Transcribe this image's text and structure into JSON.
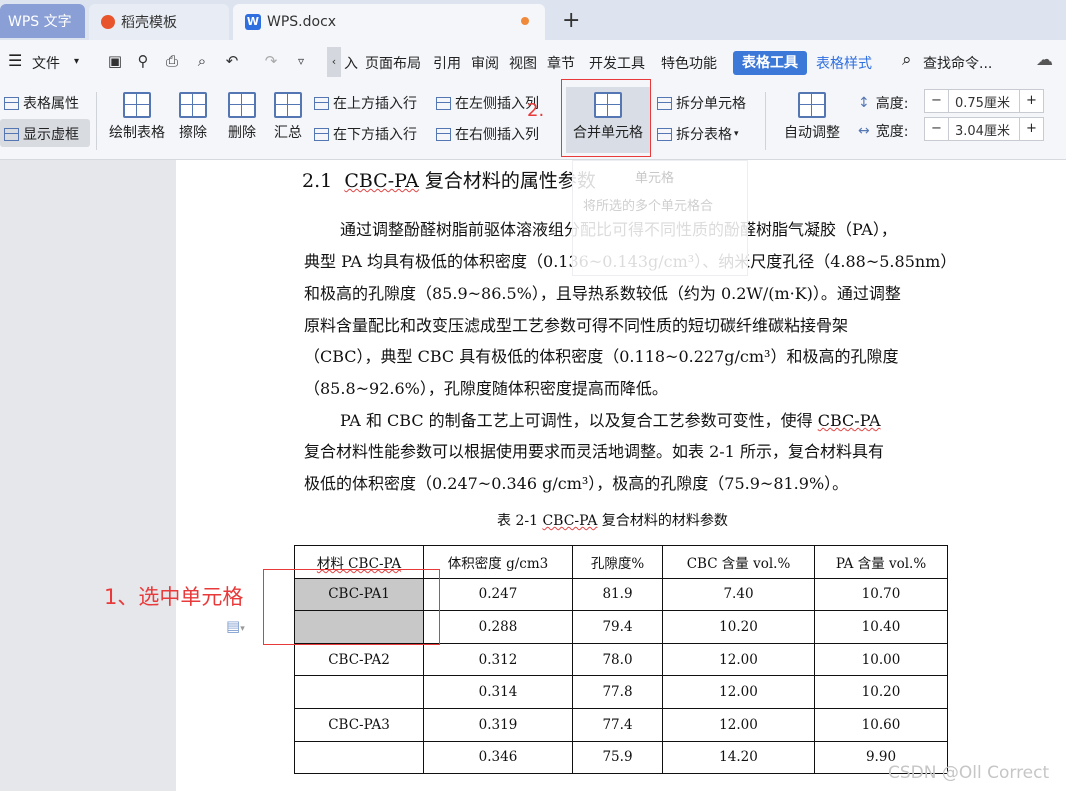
{
  "tabs": {
    "app": "WPS 文字",
    "template": "稻壳模板",
    "doc": "WPS.docx",
    "doc_icon": "W",
    "new_tab": "+"
  },
  "menu": {
    "file": "文件",
    "collapse": "‹",
    "insert_partial": "入",
    "page_layout": "页面布局",
    "references": "引用",
    "review": "审阅",
    "view": "视图",
    "chapter": "章节",
    "dev_tools": "开发工具",
    "special": "特色功能",
    "table_tools": "表格工具",
    "table_style": "表格样式",
    "search": "查找命令..."
  },
  "ribbon": {
    "table_props": "表格属性",
    "show_grid": "显示虚框",
    "draw_table": "绘制表格",
    "erase": "擦除",
    "delete": "删除",
    "summary": "汇总",
    "insert_above": "在上方插入行",
    "insert_below": "在下方插入行",
    "insert_left": "在左侧插入列",
    "insert_right": "在右侧插入列",
    "merge_cells": "合并单元格",
    "split_cells": "拆分单元格",
    "split_table": "拆分表格",
    "auto_fit": "自动调整",
    "height_label": "高度:",
    "height_value": "0.75厘米",
    "width_label": "宽度:",
    "width_value": "3.04厘米"
  },
  "tooltip": {
    "title": "单元格",
    "desc": "将所选的多个单元格合"
  },
  "annotations": {
    "step1": "1、选中单元格",
    "step2": "2."
  },
  "document": {
    "heading_num": "2.1",
    "heading_sq": "CBC-PA",
    "heading_rest": " 复合材料的属性参数",
    "p1_l1": "通过调整酚醛树脂前驱体溶液组分配比可得不同性质的酚醛树脂气凝胶（PA），",
    "p1_l2": "典型 PA 均具有极低的体积密度（0.136~0.143g/cm³）、纳米尺度孔径（4.88~5.85nm）",
    "p1_l3": "和极高的孔隙度（85.9~86.5%），且导热系数较低（约为 0.2W/(m·K)）。通过调整",
    "p1_l4": "原料含量配比和改变压滤成型工艺参数可得不同性质的短切碳纤维碳粘接骨架",
    "p1_l5": "（CBC），典型 CBC 具有极低的体积密度（0.118~0.227g/cm³）和极高的孔隙度",
    "p1_l6": "（85.8~92.6%），孔隙度随体积密度提高而降低。",
    "p2_l1a": "PA 和 CBC 的制备工艺上可调性，以及复合工艺参数可变性，使得 ",
    "p2_l1b": "CBC-PA",
    "p2_l2": "复合材料性能参数可以根据使用要求而灵活地调整。如表 2-1 所示，复合材料具有",
    "p2_l3": "极低的体积密度（0.247~0.346 g/cm³），极高的孔隙度（75.9~81.9%）。",
    "caption_a": "表 2-1 ",
    "caption_sq": "CBC-PA",
    "caption_b": " 复合材料的材料参数"
  },
  "table": {
    "headers": [
      "材料 CBC-PA",
      "体积密度 g/cm3",
      "孔隙度%",
      "CBC 含量 vol.%",
      "PA 含量 vol.%"
    ],
    "rows": [
      [
        "CBC-PA1",
        "0.247",
        "81.9",
        "7.40",
        "10.70"
      ],
      [
        "",
        "0.288",
        "79.4",
        "10.20",
        "10.40"
      ],
      [
        "CBC-PA2",
        "0.312",
        "78.0",
        "12.00",
        "10.00"
      ],
      [
        "",
        "0.314",
        "77.8",
        "12.00",
        "10.20"
      ],
      [
        "CBC-PA3",
        "0.319",
        "77.4",
        "12.00",
        "10.60"
      ],
      [
        "",
        "0.346",
        "75.9",
        "14.20",
        "9.90"
      ]
    ]
  },
  "watermark": "CSDN @Oll Correct",
  "colors": {
    "accent": "#3c78d8",
    "annotation": "#e83a3a",
    "selection": "#c8c8c8"
  }
}
